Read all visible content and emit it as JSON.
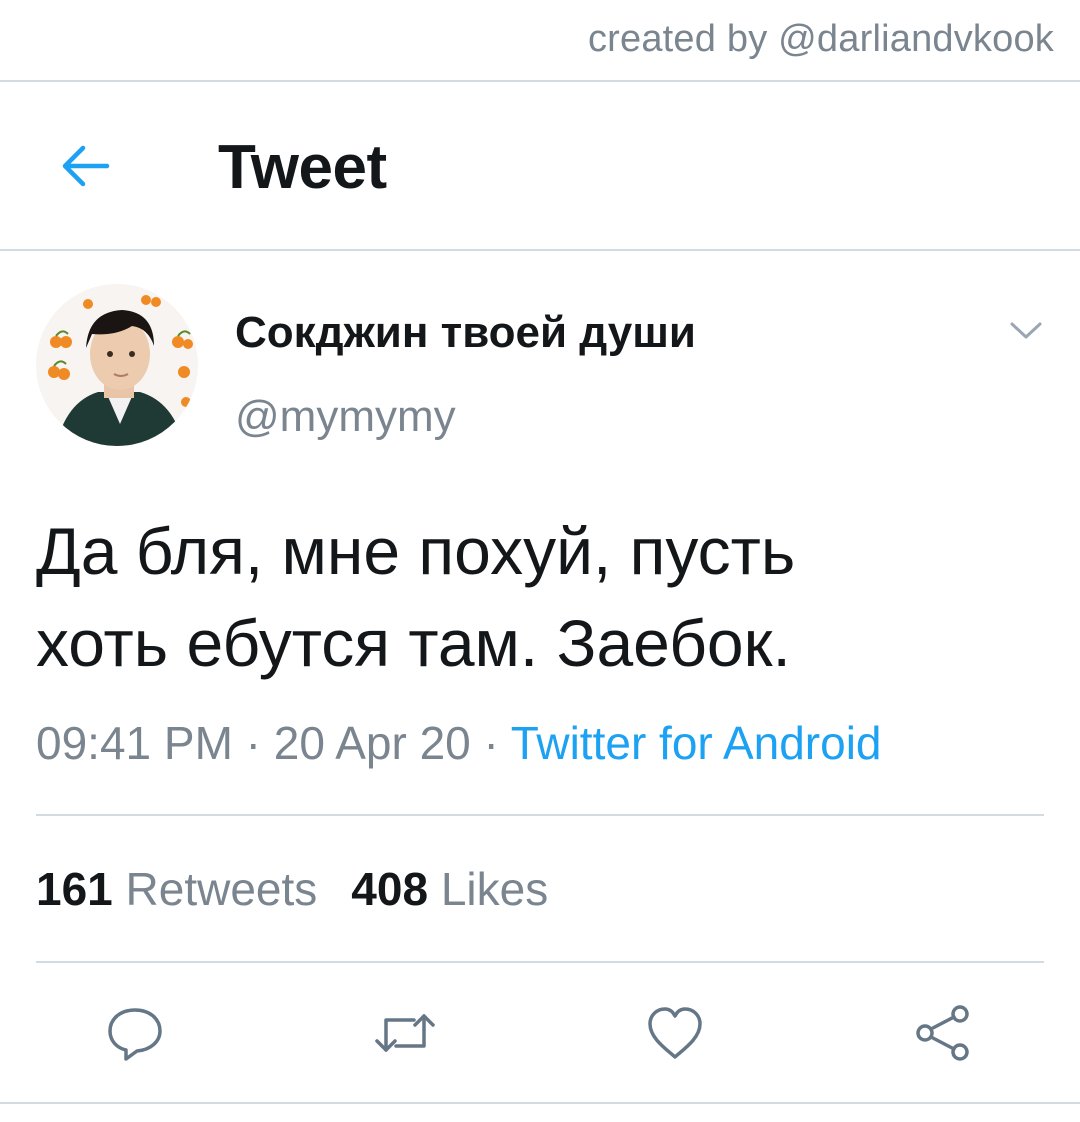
{
  "watermark": {
    "text": "created by @darliandvkook"
  },
  "header": {
    "title": "Tweet",
    "back_icon": "arrow-left-icon"
  },
  "tweet": {
    "author_name": "Сокджин твоей души",
    "author_handle": "@mymymy",
    "text_line1": "Да бля, мне похуй, пусть",
    "text_line2": "хоть ебутся там. Заебок.",
    "time": "09:41 PM",
    "separator": " · ",
    "date": "20 Apr 20",
    "source": "Twitter for Android"
  },
  "stats": {
    "retweets_count": "161",
    "retweets_label": "Retweets",
    "likes_count": "408",
    "likes_label": "Likes"
  },
  "actions": {
    "reply_icon": "reply-bubble-icon",
    "retweet_icon": "retweet-icon",
    "like_icon": "heart-icon",
    "share_icon": "share-icon"
  },
  "colors": {
    "accent": "#1da1f2",
    "text": "#14171a",
    "secondary": "#7a8590",
    "divider": "#d3dbe2",
    "icon": "#657786"
  }
}
